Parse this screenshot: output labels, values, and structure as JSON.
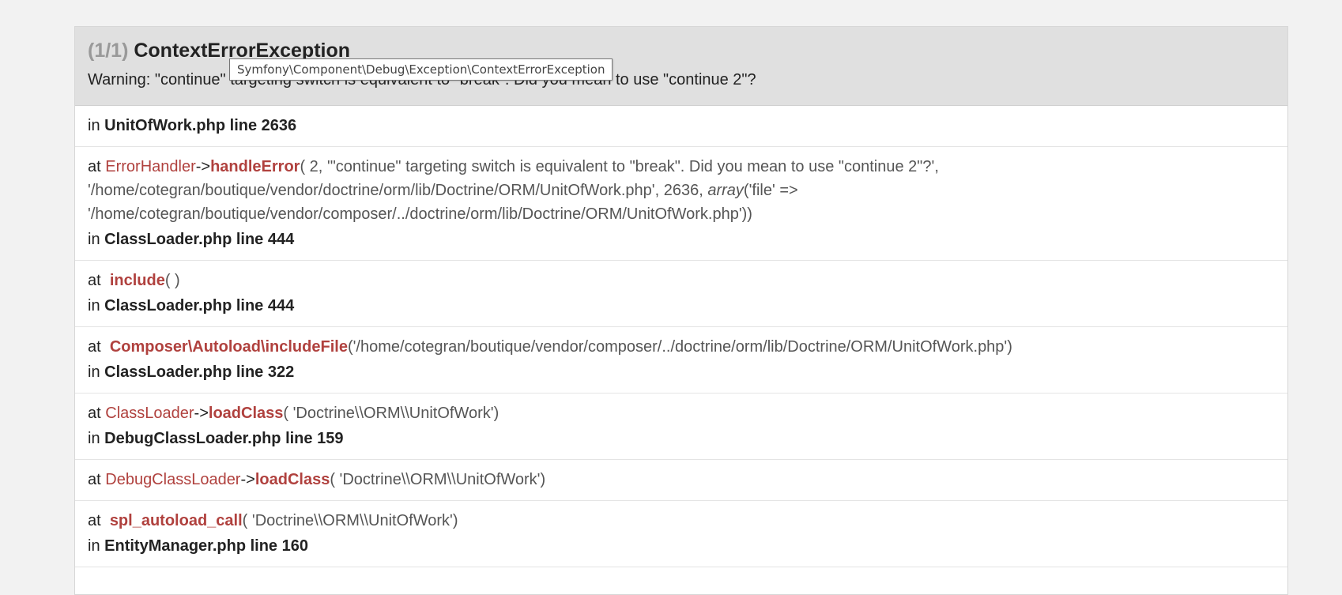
{
  "exception": {
    "count": "(1/1)",
    "name": "ContextErrorException",
    "message": "Warning: \"continue\" targeting switch is equivalent to \"break\". Did you mean to use \"continue 2\"?",
    "tooltip": "Symfony\\Component\\Debug\\Exception\\ContextErrorException"
  },
  "labels": {
    "in": "in",
    "at": "at",
    "arrow": "->",
    "array": "array"
  },
  "trace": [
    {
      "location": "UnitOfWork.php line 2636"
    },
    {
      "class": "ErrorHandler",
      "function": "handleError",
      "args_line1": "( 2, '\"continue\" targeting switch is equivalent to \"break\". Did you mean to use \"continue 2\"?',",
      "args_line2_pre": "'/home/cotegran/boutique/vendor/doctrine/orm/lib/Doctrine/ORM/UnitOfWork.php', 2636, ",
      "args_line2_post": "('file' =>",
      "args_line3": "'/home/cotegran/boutique/vendor/composer/../doctrine/orm/lib/Doctrine/ORM/UnitOfWork.php'))",
      "location": "ClassLoader.php line 444"
    },
    {
      "function": "include",
      "args": "( )",
      "location": "ClassLoader.php line 444"
    },
    {
      "function": "Composer\\Autoload\\includeFile",
      "args": "('/home/cotegran/boutique/vendor/composer/../doctrine/orm/lib/Doctrine/ORM/UnitOfWork.php')",
      "location": "ClassLoader.php line 322"
    },
    {
      "class": "ClassLoader",
      "function": "loadClass",
      "args": "( 'Doctrine\\\\ORM\\\\UnitOfWork')",
      "location": "DebugClassLoader.php line 159"
    },
    {
      "class": "DebugClassLoader",
      "function": "loadClass",
      "args": "( 'Doctrine\\\\ORM\\\\UnitOfWork')"
    },
    {
      "function": "spl_autoload_call",
      "args": "( 'Doctrine\\\\ORM\\\\UnitOfWork')",
      "location": "EntityManager.php line 160"
    }
  ]
}
